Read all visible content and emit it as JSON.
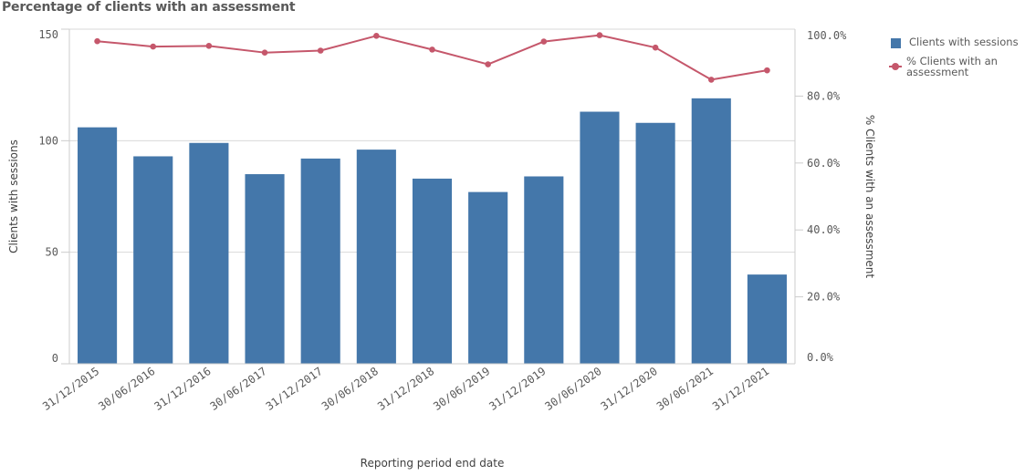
{
  "chart_data": {
    "type": "bar+line",
    "title": "Percentage of clients with an assessment",
    "xlabel": "Reporting period end date",
    "categories": [
      "31/12/2015",
      "30/06/2016",
      "31/12/2016",
      "30/06/2017",
      "31/12/2017",
      "30/06/2018",
      "31/12/2018",
      "30/06/2019",
      "31/12/2019",
      "30/06/2020",
      "31/12/2020",
      "30/06/2021",
      "31/12/2021"
    ],
    "series": [
      {
        "name": "Clients with sessions",
        "type": "bar",
        "axis": "left",
        "color": "#4477aa",
        "values": [
          106,
          93,
          99,
          85,
          92,
          96,
          83,
          77,
          84,
          113,
          108,
          119,
          40
        ]
      },
      {
        "name": "% Clients with an assessment",
        "type": "line",
        "axis": "right",
        "color": "#c5576b",
        "values": [
          96.4,
          94.8,
          95.0,
          93.0,
          93.6,
          98.0,
          93.9,
          89.5,
          96.3,
          98.2,
          94.5,
          84.9,
          87.7
        ]
      }
    ],
    "y_left": {
      "label": "Clients with sessions",
      "ylim": [
        0,
        150
      ],
      "ticks": [
        0,
        50,
        100,
        150
      ],
      "tick_labels": [
        "0",
        "50",
        "100",
        "150"
      ]
    },
    "y_right": {
      "label": "% Clients with an assessment",
      "ylim": [
        0,
        100
      ],
      "ticks": [
        0,
        20,
        40,
        60,
        80,
        100
      ],
      "tick_labels": [
        "0.0%",
        "20.0%",
        "40.0%",
        "60.0%",
        "80.0%",
        "100.0%"
      ]
    },
    "grid": true,
    "legend_position": "top-right"
  },
  "legend": {
    "items": [
      {
        "label": "Clients with sessions",
        "color": "#4477aa",
        "kind": "bar"
      },
      {
        "label": "% Clients with an assessment",
        "color": "#c5576b",
        "kind": "line"
      }
    ]
  }
}
